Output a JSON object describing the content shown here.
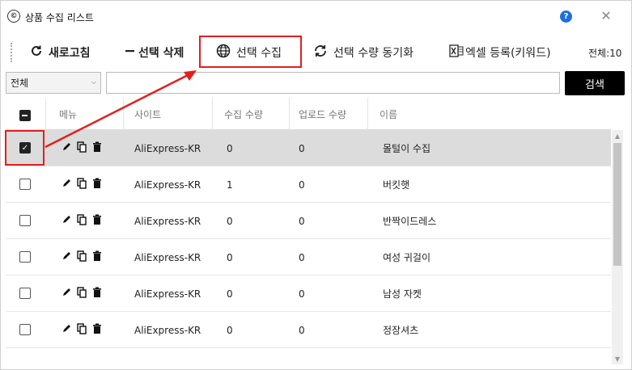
{
  "window": {
    "app_icon_glyph": "©",
    "title": "상품 수집 리스트",
    "help_label": "?",
    "close_label": "✕"
  },
  "toolbar": {
    "refresh": {
      "icon": "refresh-icon",
      "label": "새로고침"
    },
    "delete_selected": {
      "icon": "minus-icon",
      "label": "선택 삭제"
    },
    "collect_selected": {
      "icon": "globe-icon",
      "label": "선택 수집"
    },
    "sync_qty": {
      "icon": "sync-icon",
      "label": "선택 수량 동기화"
    },
    "excel_register": {
      "icon": "excel-icon",
      "label": "엑셀 등록(키워드)"
    },
    "total": "전체:10"
  },
  "filter": {
    "select_value": "전체",
    "search_value": "",
    "search_button": "검색"
  },
  "table": {
    "columns": [
      "메뉴",
      "사이트",
      "수집 수량",
      "업로드 수량",
      "이름"
    ],
    "rows": [
      {
        "checked": true,
        "site": "AliExpress-KR",
        "collect_qty": "0",
        "upload_qty": "0",
        "name": "몰털이 수집"
      },
      {
        "checked": false,
        "site": "AliExpress-KR",
        "collect_qty": "1",
        "upload_qty": "0",
        "name": "버킷햇"
      },
      {
        "checked": false,
        "site": "AliExpress-KR",
        "collect_qty": "0",
        "upload_qty": "0",
        "name": "반짝이드레스"
      },
      {
        "checked": false,
        "site": "AliExpress-KR",
        "collect_qty": "0",
        "upload_qty": "0",
        "name": "여성 귀걸이"
      },
      {
        "checked": false,
        "site": "AliExpress-KR",
        "collect_qty": "0",
        "upload_qty": "0",
        "name": "남성 자켓"
      },
      {
        "checked": false,
        "site": "AliExpress-KR",
        "collect_qty": "0",
        "upload_qty": "0",
        "name": "정장셔츠"
      }
    ]
  },
  "colors": {
    "highlight": "#e0201f",
    "selected_row": "#dcdcdc",
    "search_button_bg": "#000000",
    "help_button_bg": "#1e6fd9"
  }
}
